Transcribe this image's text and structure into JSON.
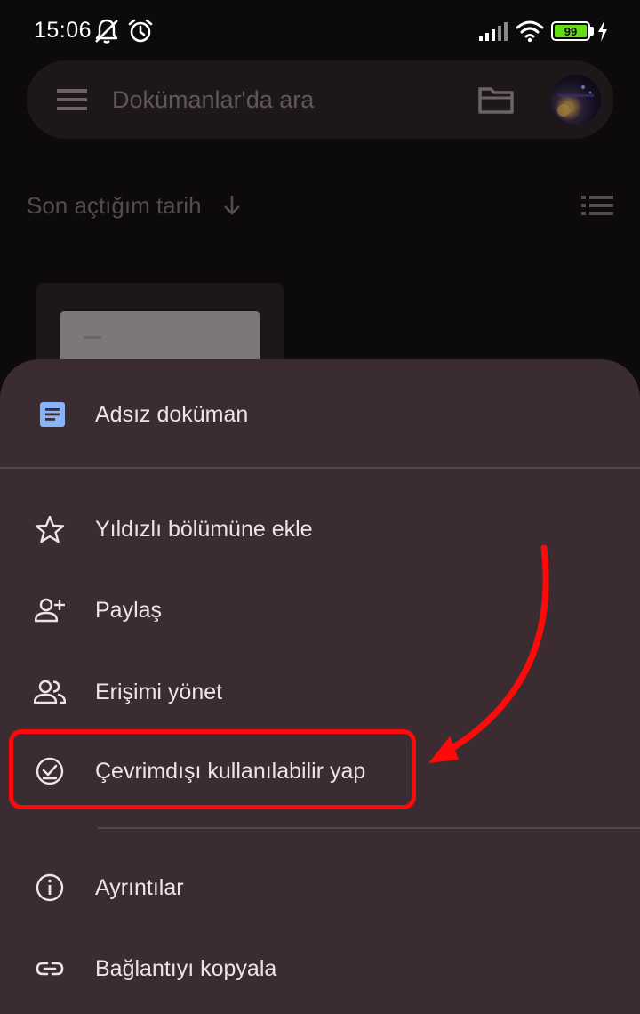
{
  "status_bar": {
    "time": "15:06",
    "battery": "99",
    "icons": [
      "mute-icon",
      "alarm-icon",
      "signal-icon",
      "wifi-icon",
      "battery-icon",
      "charging-icon"
    ]
  },
  "search": {
    "placeholder": "Dokümanlar'da ara",
    "menu_icon": "hamburger-menu-icon",
    "folder_icon": "folder-icon"
  },
  "sort": {
    "label": "Son açtığım tarih",
    "direction_icon": "arrow-down-icon",
    "view_icon": "list-view-icon"
  },
  "sheet": {
    "doc_icon": "docs-file-icon",
    "title": "Adsız doküman",
    "items": [
      {
        "label": "Yıldızlı bölümüne ekle",
        "icon": "star-icon"
      },
      {
        "label": "Paylaş",
        "icon": "person-add-icon"
      },
      {
        "label": "Erişimi yönet",
        "icon": "people-icon"
      },
      {
        "label": "Çevrimdışı kullanılabilir yap",
        "icon": "offline-check-icon",
        "highlighted": true
      },
      {
        "label": "Ayrıntılar",
        "icon": "info-icon"
      },
      {
        "label": "Bağlantıyı kopyala",
        "icon": "link-icon"
      }
    ]
  },
  "colors": {
    "background": "#0d0a0c",
    "sheet": "#3a2c31",
    "docs_blue": "#8ab4f8",
    "annotation_red": "#ff0a0a",
    "battery_green": "#64dd17"
  }
}
